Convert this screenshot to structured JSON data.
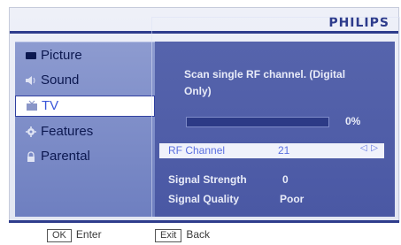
{
  "brand": "PHILIPS",
  "menu": {
    "items": [
      {
        "label": "Picture",
        "icon": "picture-icon"
      },
      {
        "label": "Sound",
        "icon": "sound-icon"
      },
      {
        "label": "TV",
        "icon": "tv-icon",
        "selected": true
      },
      {
        "label": "Features",
        "icon": "gear-icon"
      },
      {
        "label": "Parental",
        "icon": "lock-icon"
      }
    ]
  },
  "scan": {
    "description": "Scan single RF channel. (Digital Only)",
    "progress_text": "0%",
    "progress_fraction": 0
  },
  "rf_channel": {
    "label": "RF Channel",
    "value": "21",
    "arrows": "◁ ▷"
  },
  "signal": {
    "strength_label": "Signal Strength",
    "strength_value": "0",
    "quality_label": "Signal Quality",
    "quality_value": "Poor"
  },
  "footer": {
    "ok_key": "OK",
    "ok_label": "Enter",
    "exit_key": "Exit",
    "exit_label": "Back"
  },
  "colors": {
    "accent": "#2e3c8c",
    "menu_panel": "#7d8cc8",
    "content_panel": "#5060a8",
    "highlight_text": "#5a6fe0"
  }
}
